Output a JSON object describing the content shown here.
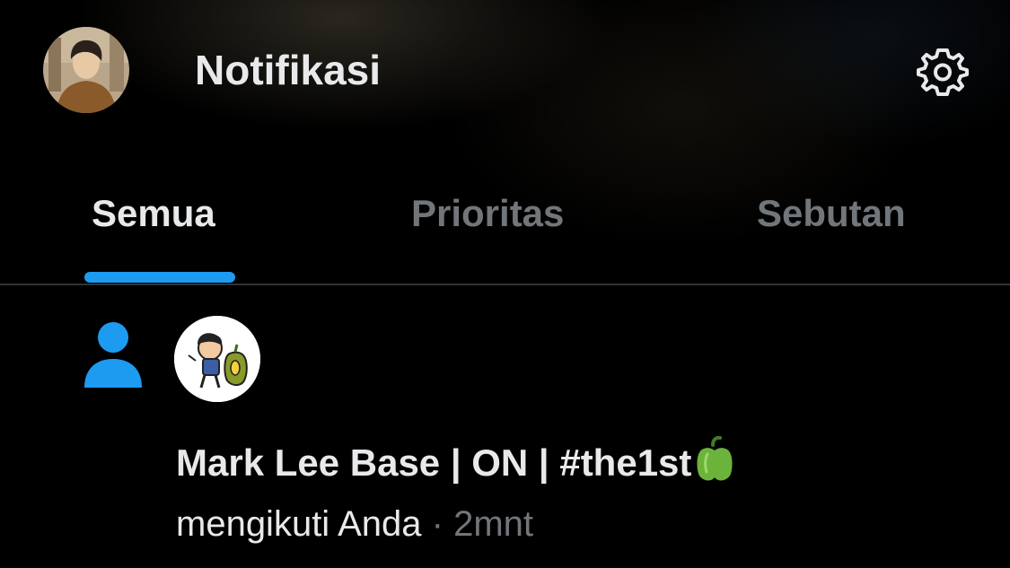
{
  "header": {
    "title": "Notifikasi",
    "avatar_icon": "user-avatar",
    "settings_icon": "gear-icon"
  },
  "tabs": [
    {
      "label": "Semua",
      "active": true
    },
    {
      "label": "Prioritas",
      "active": false
    },
    {
      "label": "Sebutan",
      "active": false
    }
  ],
  "colors": {
    "accent": "#1d9bf0",
    "text_primary": "#e7e9ea",
    "text_secondary": "#71767b",
    "background": "#000000"
  },
  "notification": {
    "type_icon": "person-icon",
    "avatar_icon": "cartoon-avatar",
    "user_name": "Mark Lee Base | ON | #the1st",
    "name_emoji": "green-pepper-emoji",
    "action": "mengikuti Anda",
    "separator": "·",
    "time": "2mnt"
  }
}
